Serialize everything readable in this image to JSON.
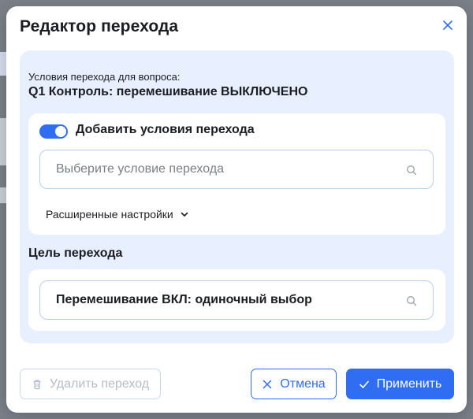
{
  "dialog": {
    "title": "Редактор перехода",
    "close_icon": "close-icon"
  },
  "conditions": {
    "caption": "Условия перехода для вопроса:",
    "question": "Q1 Контроль: перемешивание ВЫКЛЮЧЕНО",
    "toggle_label": "Добавить условия перехода",
    "toggle_on": true,
    "search_placeholder": "Выберите условие перехода",
    "advanced_label": "Расширенные настройки"
  },
  "target": {
    "heading": "Цель перехода",
    "value": "Перемешивание ВКЛ: одиночный выбор"
  },
  "footer": {
    "delete_label": "Удалить переход",
    "cancel_label": "Отмена",
    "apply_label": "Применить"
  },
  "colors": {
    "accent": "#2f6df2",
    "panel_bg": "#e8efff",
    "disabled_text": "#b7bcc6"
  }
}
